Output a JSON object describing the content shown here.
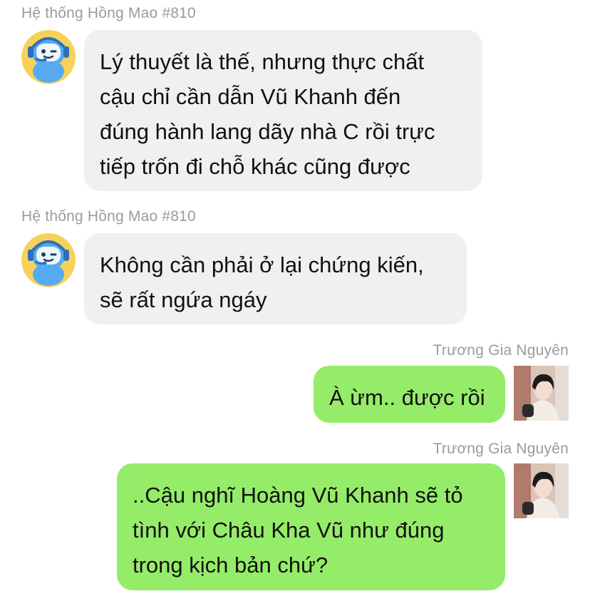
{
  "messages": [
    {
      "sender": "Hệ thống Hồng Mao #810",
      "lines": [
        "Lý thuyết là thế, nhưng thực chất",
        "cậu chỉ cần dẫn Vũ Khanh đến",
        "đúng hành lang dãy nhà C rồi trực",
        "tiếp trốn đi chỗ khác cũng được"
      ]
    },
    {
      "sender": "Hệ thống Hồng Mao #810",
      "lines": [
        "Không cần phải ở lại chứng kiến,",
        "sẽ rất ngứa ngáy"
      ]
    },
    {
      "sender": "Trương Gia Nguyên",
      "lines": [
        "À ừm.. được rồi"
      ]
    },
    {
      "sender": "Trương Gia Nguyên",
      "lines": [
        "..Cậu nghĩ Hoàng Vũ Khanh sẽ tỏ",
        "tình với Châu Kha Vũ như đúng",
        "trong kịch bản chứ?"
      ]
    }
  ],
  "colors": {
    "incoming_bubble": "#f0f0f0",
    "outgoing_bubble": "#95ec69",
    "sender_name": "#9b9b9b"
  },
  "icons": {
    "bot_avatar": "robot-mascot-icon",
    "user_avatar": "user-photo-avatar"
  }
}
